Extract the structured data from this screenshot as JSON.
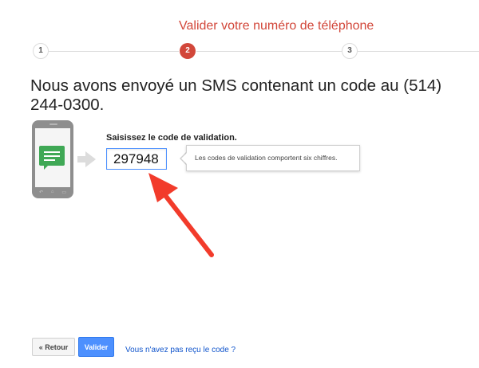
{
  "stepper": {
    "title": "Valider votre numéro de téléphone",
    "steps": [
      {
        "number": "1",
        "state": "done"
      },
      {
        "number": "2",
        "state": "active"
      },
      {
        "number": "3",
        "state": "pending"
      }
    ],
    "active_color": "#d2473a"
  },
  "headline": "Nous avons envoyé un SMS contenant un code au (514) 244-0300.",
  "phone_illustration": {
    "icon": "sms-message-icon",
    "nav_icons": [
      "back-icon",
      "home-icon",
      "recent-apps-icon"
    ]
  },
  "code_form": {
    "label": "Saisissez le code de validation.",
    "value": "297948"
  },
  "tooltip": {
    "text": "Les codes de validation comportent six chiffres."
  },
  "annotation": {
    "icon": "red-pointer-arrow-icon",
    "color": "#f23b2b"
  },
  "footer": {
    "back_label": "« Retour",
    "submit_label": "Valider",
    "help_link": "Vous n'avez pas reçu le code ?",
    "submit_color": "#4d90fe",
    "link_color": "#1155cc"
  }
}
